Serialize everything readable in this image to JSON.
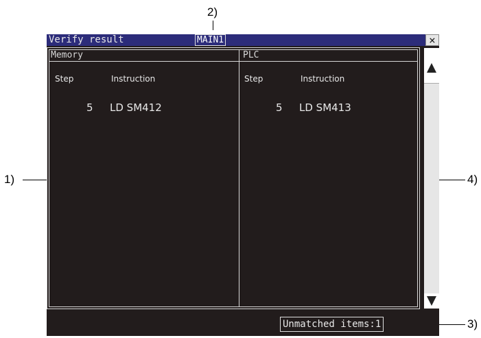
{
  "window": {
    "title": "Verify result",
    "program": "MAIN1",
    "close_glyph": "×"
  },
  "memory": {
    "label": "Memory",
    "step_header": "Step",
    "instruction_header": "Instruction",
    "step": "5",
    "instruction": "LD SM412"
  },
  "plc": {
    "label": "PLC",
    "step_header": "Step",
    "instruction_header": "Instruction",
    "step": "5",
    "instruction": "LD SM413"
  },
  "status": {
    "unmatched": "Unmatched items:1"
  },
  "callouts": {
    "c1": "1)",
    "c2": "2)",
    "c3": "3)",
    "c4": "4)"
  },
  "icons": {
    "close": "close-icon",
    "scroll_up": "triangle-up-icon",
    "scroll_down": "triangle-down-icon"
  },
  "colors": {
    "screen_bg": "#221c1c",
    "titlebar_bg": "#2c2c7a",
    "text": "#e8e8e8"
  }
}
